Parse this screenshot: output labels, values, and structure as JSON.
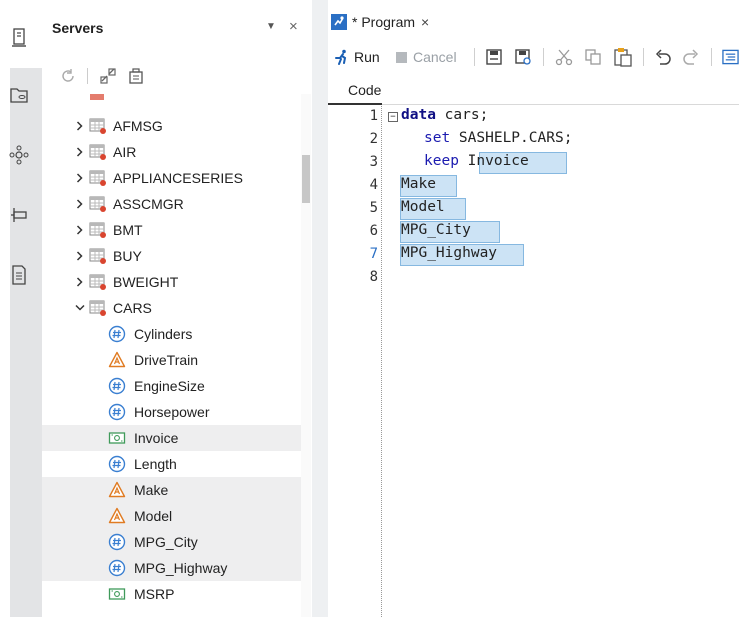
{
  "servers_panel": {
    "title": "Servers",
    "menu_glyph": "▼",
    "close_glyph": "×",
    "tree": [
      {
        "label": "AFMSG",
        "kind": "table",
        "expanded": false
      },
      {
        "label": "AIR",
        "kind": "table",
        "expanded": false
      },
      {
        "label": "APPLIANCESERIES",
        "kind": "table",
        "expanded": false
      },
      {
        "label": "ASSCMGR",
        "kind": "table",
        "expanded": false
      },
      {
        "label": "BMT",
        "kind": "table",
        "expanded": false
      },
      {
        "label": "BUY",
        "kind": "table",
        "expanded": false
      },
      {
        "label": "BWEIGHT",
        "kind": "table",
        "expanded": false
      },
      {
        "label": "CARS",
        "kind": "table",
        "expanded": true
      },
      {
        "label": "Cylinders",
        "kind": "numeric"
      },
      {
        "label": "DriveTrain",
        "kind": "character"
      },
      {
        "label": "EngineSize",
        "kind": "numeric"
      },
      {
        "label": "Horsepower",
        "kind": "numeric"
      },
      {
        "label": "Invoice",
        "kind": "currency"
      },
      {
        "label": "Length",
        "kind": "numeric"
      },
      {
        "label": "Make",
        "kind": "character"
      },
      {
        "label": "Model",
        "kind": "character"
      },
      {
        "label": "MPG_City",
        "kind": "numeric"
      },
      {
        "label": "MPG_Highway",
        "kind": "numeric"
      },
      {
        "label": "MSRP",
        "kind": "currency"
      }
    ]
  },
  "editor": {
    "tab_label": "* Program",
    "tab_close": "×",
    "toolbar": {
      "run_label": "Run",
      "cancel_label": "Cancel"
    },
    "code_tab_label": "Code",
    "line_numbers": [
      "1",
      "2",
      "3",
      "4",
      "5",
      "6",
      "7",
      "8"
    ],
    "code": {
      "l1_kw": "data",
      "l1_rest": " cars;",
      "l2_kw": "set",
      "l2_rest": " SASHELP.CARS;",
      "l3_kw": "keep",
      "l3_sel": "Invoice",
      "l4": "Make",
      "l5": "Model",
      "l6": "MPG_City",
      "l7": "MPG_Highway"
    }
  },
  "colors": {
    "accent": "#2a6fc4",
    "selection": "#cce3f5",
    "character_icon": "#e07b22",
    "table_icon": "#d9452f",
    "numeric_icon": "#3a7fd1",
    "currency_icon": "#3f9a5a"
  }
}
